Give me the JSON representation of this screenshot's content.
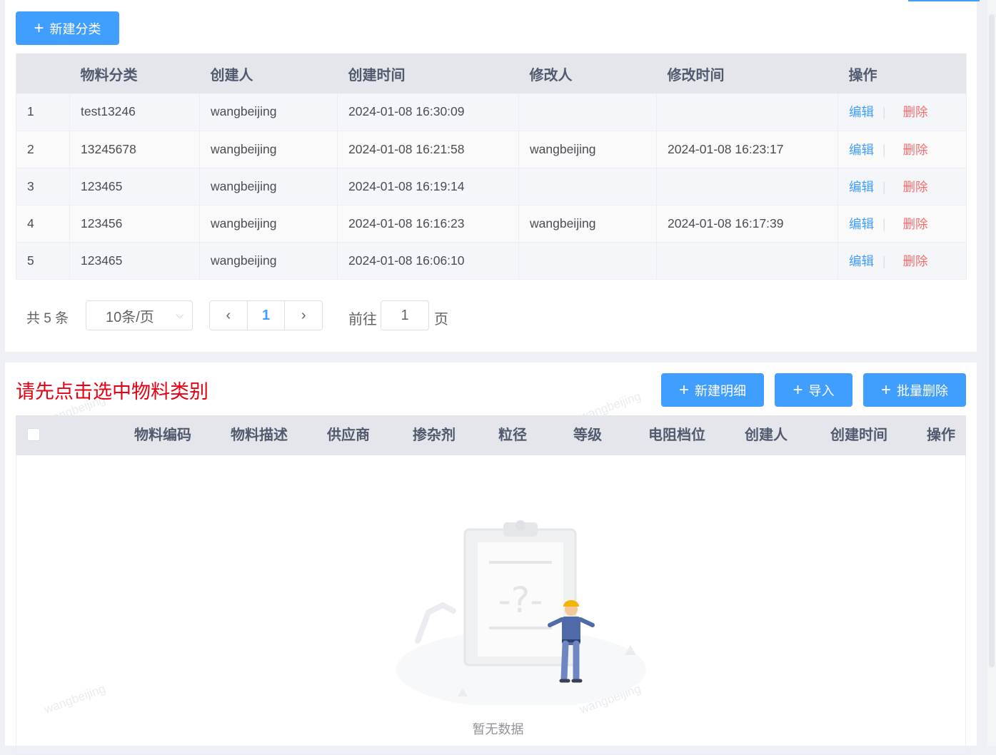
{
  "toolbar": {
    "new_category": "新建分类",
    "new_detail": "新建明细",
    "import": "导入",
    "batch_delete": "批量删除"
  },
  "category_table": {
    "headers": [
      "物料分类",
      "创建人",
      "创建时间",
      "修改人",
      "修改时间",
      "操作"
    ],
    "rows": [
      {
        "index": "1",
        "category": "test13246",
        "creator": "wangbeijing",
        "created": "2024-01-08 16:30:09",
        "modifier": "",
        "modified": ""
      },
      {
        "index": "2",
        "category": "13245678",
        "creator": "wangbeijing",
        "created": "2024-01-08 16:21:58",
        "modifier": "wangbeijing",
        "modified": "2024-01-08 16:23:17"
      },
      {
        "index": "3",
        "category": "123465",
        "creator": "wangbeijing",
        "created": "2024-01-08 16:19:14",
        "modifier": "",
        "modified": ""
      },
      {
        "index": "4",
        "category": "123456",
        "creator": "wangbeijing",
        "created": "2024-01-08 16:16:23",
        "modifier": "wangbeijing",
        "modified": "2024-01-08 16:17:39"
      },
      {
        "index": "5",
        "category": "123465",
        "creator": "wangbeijing",
        "created": "2024-01-08 16:06:10",
        "modifier": "",
        "modified": ""
      }
    ],
    "actions": {
      "edit": "编辑",
      "delete": "删除",
      "separator": "|"
    }
  },
  "pagination": {
    "total": "共 5 条",
    "page_size": "10条/页",
    "current_page": "1",
    "goto_label": "前往",
    "goto_value": "1",
    "goto_unit": "页"
  },
  "detail": {
    "hint": "请先点击选中物料类别",
    "headers": [
      "物料编码",
      "物料描述",
      "供应商",
      "掺杂剂",
      "粒径",
      "等级",
      "电阻档位",
      "创建人",
      "创建时间",
      "操作"
    ],
    "empty_text": "暂无数据"
  },
  "watermark": "wangbeijing",
  "colors": {
    "primary": "#409eff",
    "danger": "#f56c6c",
    "hint": "#e60012"
  }
}
